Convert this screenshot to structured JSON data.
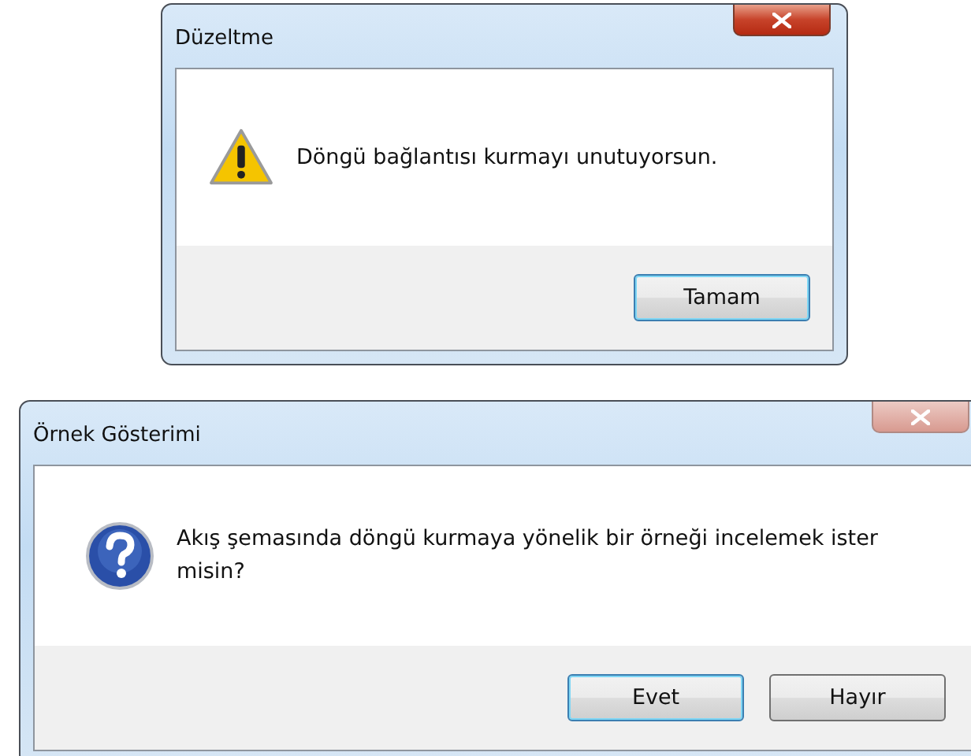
{
  "dialogs": [
    {
      "title": "Düzeltme",
      "active": true,
      "kind": "warning",
      "message": "Döngü bağlantısı kurmayı unutuyorsun.",
      "buttons": [
        {
          "label": "Tamam",
          "default": true
        }
      ]
    },
    {
      "title": "Örnek Gösterimi",
      "active": false,
      "kind": "question",
      "message": "Akış şemasında döngü kurmaya yönelik bir örneği incelemek ister misin?",
      "buttons": [
        {
          "label": "Evet",
          "default": true
        },
        {
          "label": "Hayır",
          "default": false
        }
      ]
    }
  ]
}
